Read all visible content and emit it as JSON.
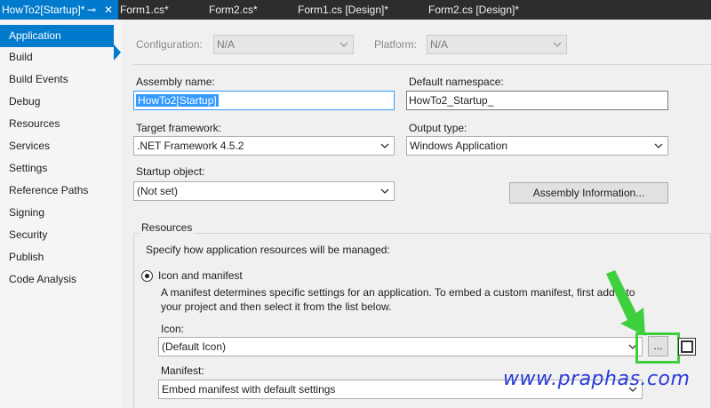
{
  "tabs": [
    {
      "label": "HowTo2[Startup]*"
    },
    {
      "label": "Form1.cs*"
    },
    {
      "label": "Form2.cs*"
    },
    {
      "label": "Form1.cs [Design]*"
    },
    {
      "label": "Form2.cs [Design]*"
    }
  ],
  "tab_pin_glyph": "⊸",
  "tab_close_glyph": "✕",
  "sidebar": {
    "items": [
      {
        "label": "Application"
      },
      {
        "label": "Build"
      },
      {
        "label": "Build Events"
      },
      {
        "label": "Debug"
      },
      {
        "label": "Resources"
      },
      {
        "label": "Services"
      },
      {
        "label": "Settings"
      },
      {
        "label": "Reference Paths"
      },
      {
        "label": "Signing"
      },
      {
        "label": "Security"
      },
      {
        "label": "Publish"
      },
      {
        "label": "Code Analysis"
      }
    ],
    "active_index": 0
  },
  "config": {
    "configuration_label": "Configuration:",
    "configuration_value": "N/A",
    "platform_label": "Platform:",
    "platform_value": "N/A"
  },
  "app": {
    "assembly_name_label": "Assembly name:",
    "assembly_name_value": "HowTo2[Startup]",
    "default_namespace_label": "Default namespace:",
    "default_namespace_value": "HowTo2_Startup_",
    "target_framework_label": "Target framework:",
    "target_framework_value": ".NET Framework 4.5.2",
    "output_type_label": "Output type:",
    "output_type_value": "Windows Application",
    "startup_object_label": "Startup object:",
    "startup_object_value": "(Not set)",
    "assembly_info_button": "Assembly Information..."
  },
  "resources": {
    "section_title": "Resources",
    "description": "Specify how application resources will be managed:",
    "icon_manifest_radio": "Icon and manifest",
    "manifest_help_line1": "A manifest determines specific settings for an application. To embed a custom manifest, first add it to",
    "manifest_help_line2": "your project and then select it from the list below.",
    "icon_label": "Icon:",
    "icon_value": "(Default Icon)",
    "browse_button": "...",
    "manifest_label": "Manifest:",
    "manifest_value": "Embed manifest with default settings"
  },
  "watermark": "www.praphas.com",
  "colors": {
    "accent": "#007acc",
    "tab_bar": "#2d2d30",
    "highlight_green": "#3ecf3e",
    "watermark_blue": "#2a3bd8"
  }
}
